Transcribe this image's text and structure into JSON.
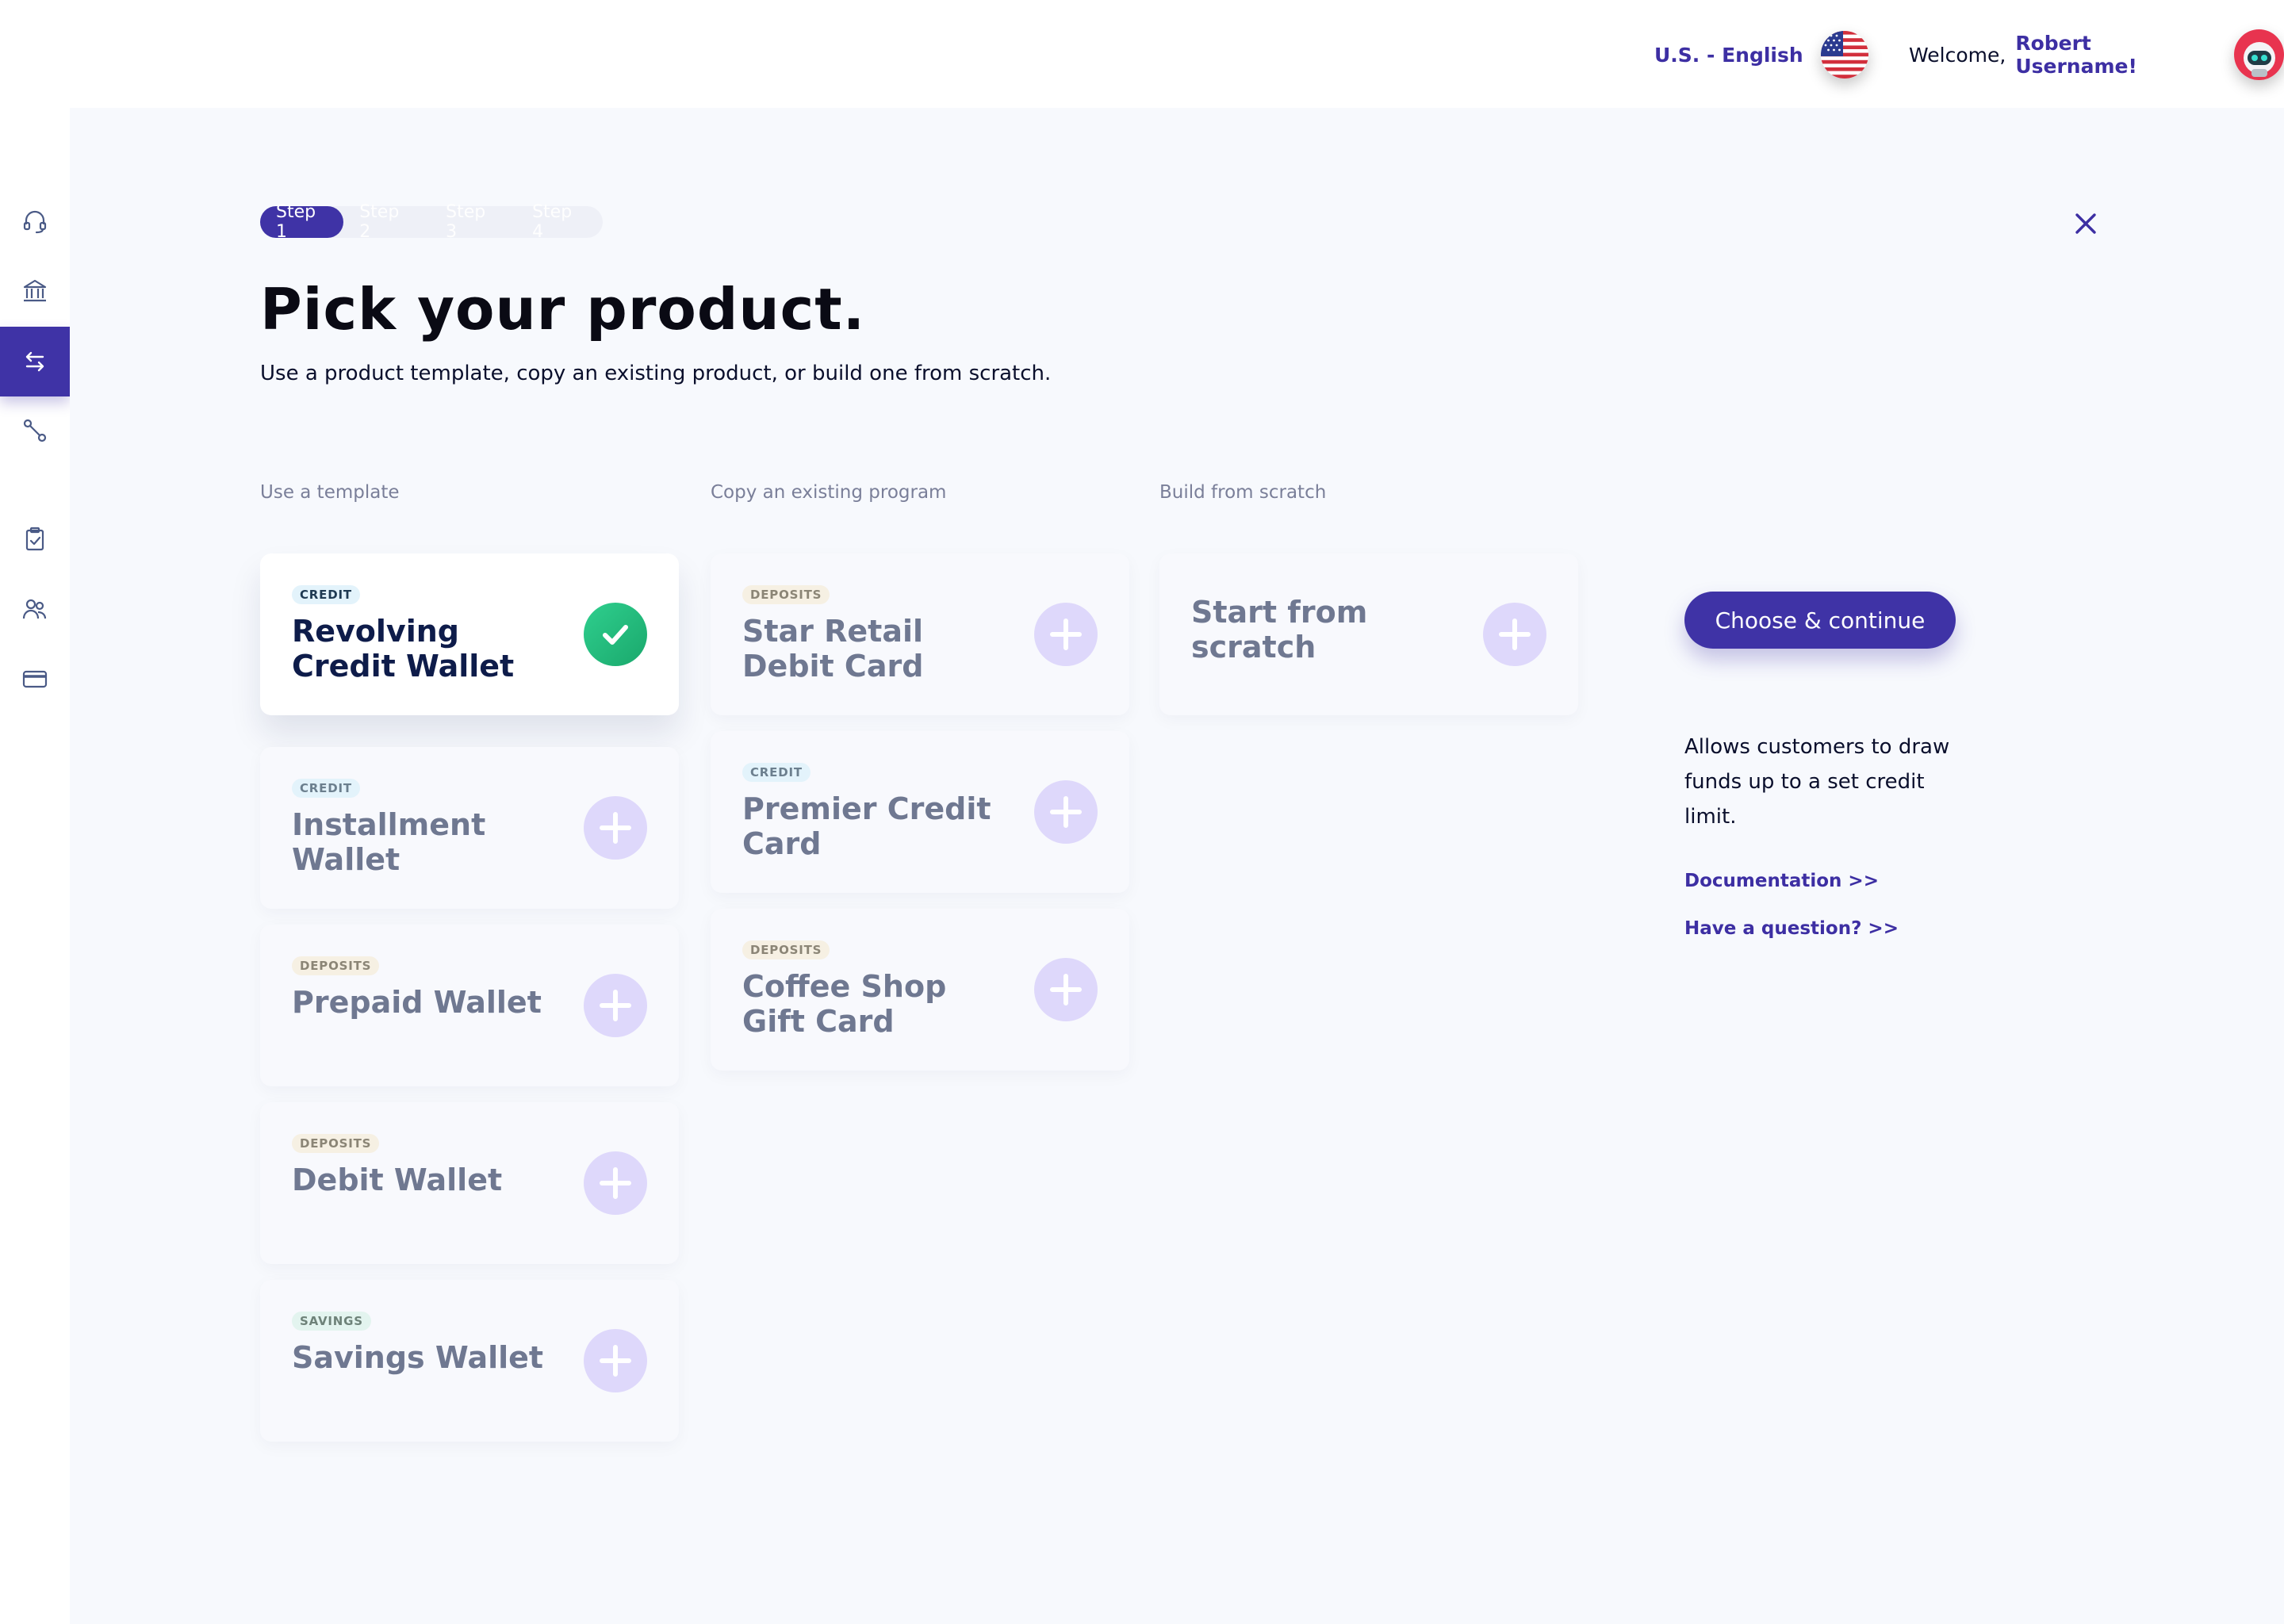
{
  "header": {
    "language_label": "U.S. - English",
    "welcome_text": "Welcome,",
    "user_name": "Robert Username!"
  },
  "sidebar": {
    "items": [
      {
        "icon": "headset-icon"
      },
      {
        "icon": "bank-icon"
      },
      {
        "icon": "transfer-arrows-icon",
        "active": true
      },
      {
        "icon": "connection-nodes-icon"
      },
      {
        "icon": "clipboard-check-icon"
      },
      {
        "icon": "users-icon"
      },
      {
        "icon": "credit-card-icon"
      }
    ]
  },
  "steps": [
    "Step 1",
    "Step 2",
    "Step 3",
    "Step 4"
  ],
  "page": {
    "title": "Pick your product.",
    "subtitle": "Use a product template, copy an existing product, or build one from scratch."
  },
  "columns": {
    "template": "Use a template",
    "copy": "Copy an existing program",
    "scratch": "Build from scratch"
  },
  "templates": [
    {
      "badge": "CREDIT",
      "title": "Revolving Credit Wallet",
      "selected": true
    },
    {
      "badge": "CREDIT",
      "title": "Installment Wallet"
    },
    {
      "badge": "DEPOSITS",
      "title": "Prepaid Wallet"
    },
    {
      "badge": "DEPOSITS",
      "title": "Debit Wallet"
    },
    {
      "badge": "SAVINGS",
      "title": "Savings Wallet"
    }
  ],
  "existing": [
    {
      "badge": "DEPOSITS",
      "title": "Star Retail Debit Card"
    },
    {
      "badge": "CREDIT",
      "title": "Premier Credit Card"
    },
    {
      "badge": "DEPOSITS",
      "title": "Coffee Shop Gift Card"
    }
  ],
  "scratch": {
    "title": "Start from scratch"
  },
  "cta_label": "Choose & continue",
  "description": "Allows customers to draw funds up to a set credit limit.",
  "links": {
    "documentation": "Documentation >>",
    "question": "Have a question? >>"
  },
  "colors": {
    "accent": "#3f33a6",
    "success": "#22bb7c",
    "plus_circle": "#ded8fb",
    "background": "#f7f9fd"
  }
}
